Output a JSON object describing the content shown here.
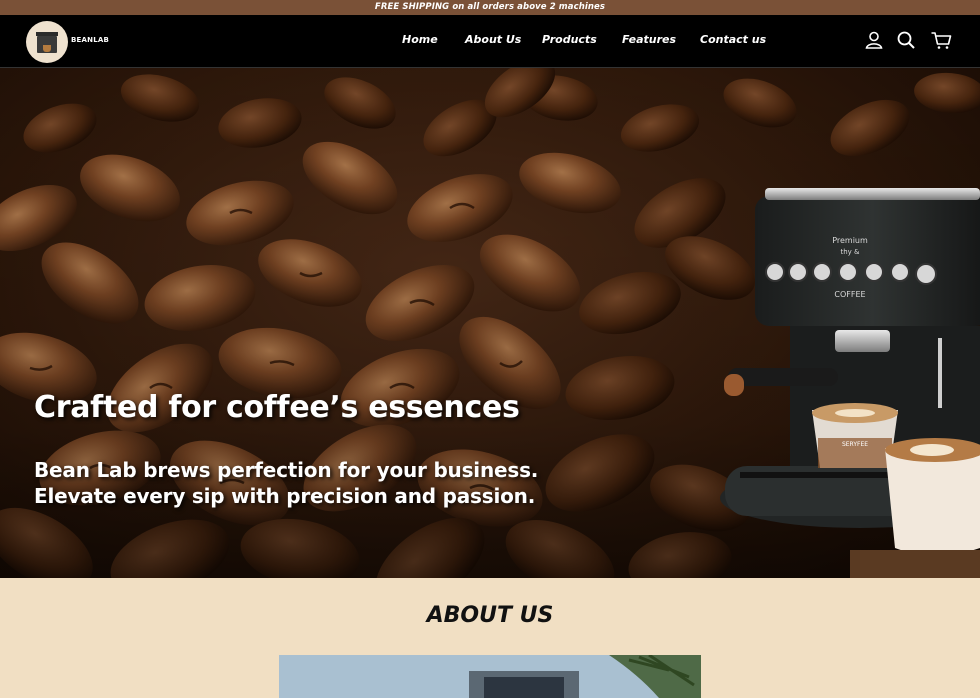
{
  "announcement": "FREE SHIPPING on all orders above 2 machines",
  "brand": {
    "name": "BEANLAB"
  },
  "nav": [
    "Home",
    "About Us",
    "Products",
    "Features",
    "Contact us"
  ],
  "icons": {
    "account": "user-icon",
    "search": "search-icon",
    "cart": "cart-icon"
  },
  "hero": {
    "title": "Crafted for coffee’s essences",
    "subtitle": "Bean Lab brews perfection for your business. Elevate every sip with precision and passion.",
    "machine_panel_text": "Premium",
    "machine_panel_text2": "thy &",
    "machine_label": "COFFEE",
    "cup_label": "SERYFEE"
  },
  "about": {
    "title": "ABOUT US"
  },
  "colors": {
    "announcement_bg": "#7a5137",
    "header_bg": "#000000",
    "section_bg": "#f1dfc3"
  }
}
